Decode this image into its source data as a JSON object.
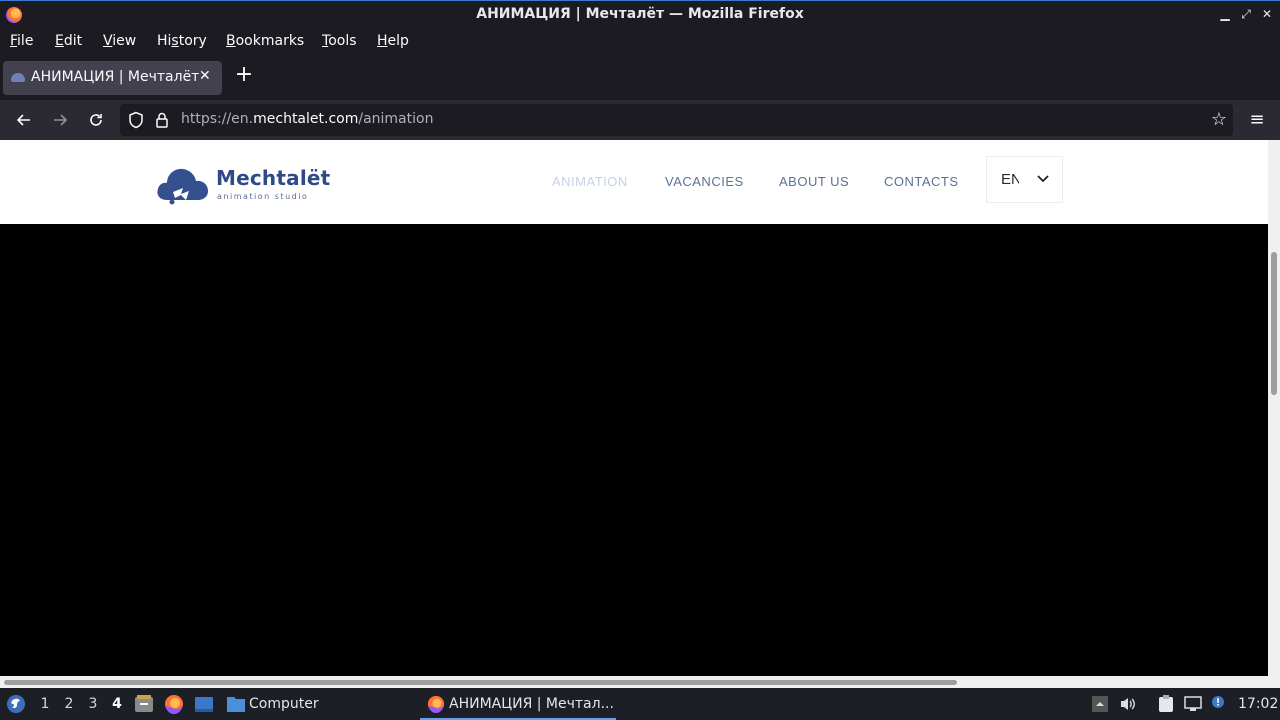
{
  "window": {
    "title": "АНИМАЦИЯ | Мечталёт — Mozilla Firefox"
  },
  "menubar": {
    "items": [
      {
        "label": "File",
        "accel": "F",
        "rest": "ile"
      },
      {
        "label": "Edit",
        "accel": "E",
        "rest": "dit"
      },
      {
        "label": "View",
        "accel": "V",
        "rest": "iew"
      },
      {
        "label": "History",
        "pre": "Hi",
        "accel": "s",
        "rest": "tory"
      },
      {
        "label": "Bookmarks",
        "accel": "B",
        "rest": "ookmarks"
      },
      {
        "label": "Tools",
        "accel": "T",
        "rest": "ools"
      },
      {
        "label": "Help",
        "accel": "H",
        "rest": "elp"
      }
    ]
  },
  "tabs": [
    {
      "title": "АНИМАЦИЯ | Мечталёт",
      "active": true
    }
  ],
  "navbar": {
    "url_prefix": "https://en.",
    "url_host": "mechtalet.com",
    "url_path": "/animation"
  },
  "site": {
    "logo": {
      "name": "Mechtalët",
      "tagline": "animation studio"
    },
    "nav": [
      {
        "label": "ANIMATION",
        "active": true
      },
      {
        "label": "VACANCIES",
        "active": false
      },
      {
        "label": "ABOUT US",
        "active": false
      },
      {
        "label": "CONTACTS",
        "active": false
      }
    ],
    "language": "EN"
  },
  "taskbar": {
    "workspaces": [
      "1",
      "2",
      "3",
      "4"
    ],
    "active_workspace": "4",
    "files_label": "Computer",
    "firefox_task": "АНИМАЦИЯ | Мечтал...",
    "clock": "17:02"
  },
  "colors": {
    "chrome_dark": "#1c1b22",
    "toolbar": "#2b2a33",
    "brand": "#2f4a86",
    "nav_text": "#5b7292"
  }
}
